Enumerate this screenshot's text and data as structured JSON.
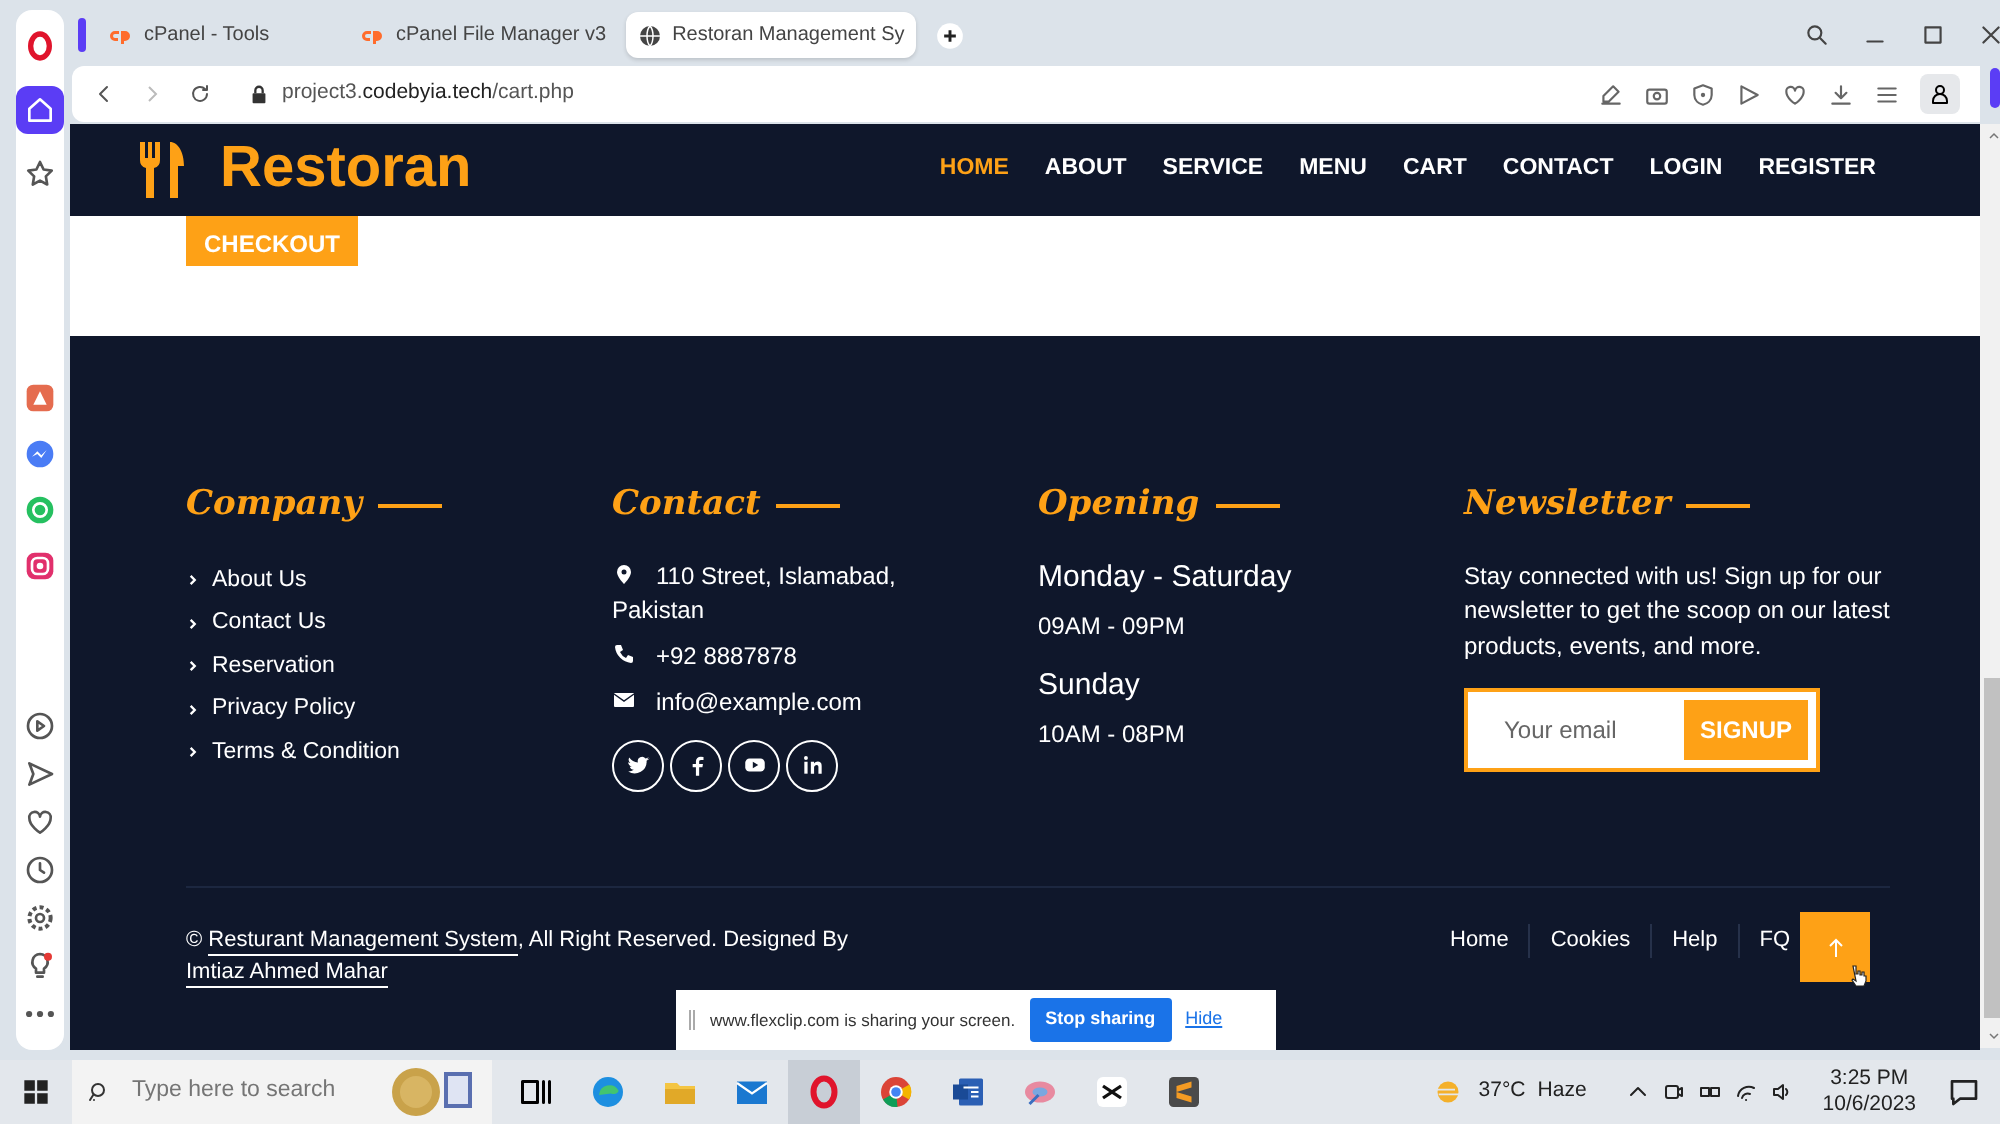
{
  "sidebar": {
    "top": [
      {
        "kind": "opera",
        "selected": false
      },
      {
        "kind": "home",
        "selected": true
      },
      {
        "kind": "star",
        "selected": false
      }
    ],
    "apps": [
      {
        "kind": "aria",
        "selected": false
      },
      {
        "kind": "messenger",
        "selected": false
      },
      {
        "kind": "whatsapp",
        "selected": false
      },
      {
        "kind": "instagram",
        "selected": false
      }
    ],
    "bottom": [
      {
        "kind": "player",
        "selected": false
      },
      {
        "kind": "send",
        "selected": false
      },
      {
        "kind": "heart",
        "selected": false
      },
      {
        "kind": "history",
        "selected": false
      },
      {
        "kind": "settings",
        "selected": false
      },
      {
        "kind": "tips",
        "selected": false
      },
      {
        "kind": "more",
        "selected": false
      }
    ]
  },
  "tabs": [
    {
      "label": "cPanel - Tools",
      "kind": "cpanel",
      "selected": false
    },
    {
      "label": "cPanel File Manager v3",
      "kind": "cpanel",
      "selected": false
    },
    {
      "label": "Restoran Management Sy",
      "kind": "globe",
      "selected": true
    }
  ],
  "address_bar": {
    "url": "project3.**codebyia.tech**/cart.php"
  },
  "site": {
    "brand": "Restoran",
    "nav": [
      {
        "label": "HOME",
        "selected": true
      },
      {
        "label": "ABOUT",
        "selected": false
      },
      {
        "label": "SERVICE",
        "selected": false
      },
      {
        "label": "MENU",
        "selected": false
      },
      {
        "label": "CART",
        "selected": false
      },
      {
        "label": "CONTACT",
        "selected": false
      },
      {
        "label": "LOGIN",
        "selected": false
      },
      {
        "label": "REGISTER",
        "selected": false
      }
    ],
    "checkout": "CHECKOUT"
  },
  "footer": {
    "columns": [
      {
        "kind": "links",
        "title": "Company",
        "items": [
          "About Us",
          "Contact Us",
          "Reservation",
          "Privacy Policy",
          "Terms & Condition"
        ]
      },
      {
        "kind": "contact",
        "title": "Contact",
        "items": [
          {
            "kind": "address",
            "text": "110 Street, Islamabad, Pakistan"
          },
          {
            "kind": "phone",
            "text": "+92 8887878"
          },
          {
            "kind": "email",
            "text": "info@example.com"
          }
        ],
        "social": [
          {
            "kind": "twitter"
          },
          {
            "kind": "facebook"
          },
          {
            "kind": "youtube"
          },
          {
            "kind": "linkedin"
          }
        ]
      },
      {
        "kind": "hours",
        "title": "Opening",
        "items": [
          {
            "day": "Monday - Saturday",
            "time": "09AM - 09PM"
          },
          {
            "day": "Sunday",
            "time": "10AM - 08PM"
          }
        ]
      },
      {
        "kind": "newsletter",
        "title": "Newsletter",
        "text": "Stay connected with us! Sign up for our newsletter to get the scoop on our latest products, events, and more.",
        "placeholder": "Your email",
        "button": "SIGNUP"
      }
    ],
    "copyright": [
      {
        "text": "© ",
        "link": false
      },
      {
        "text": "Resturant Management System",
        "link": true
      },
      {
        "text": ", All Right Reserved. Designed By ",
        "link": false
      },
      {
        "text": "Imtiaz Ahmed Mahar",
        "link": true
      }
    ],
    "links": [
      "Home",
      "Cookies",
      "Help",
      "FQ"
    ]
  },
  "share_bar": {
    "message": "www.flexclip.com is sharing your screen.",
    "stop": "Stop sharing",
    "hide": "Hide"
  },
  "taskbar": {
    "search_placeholder": "Type here to search",
    "apps": [
      {
        "kind": "taskview",
        "selected": false
      },
      {
        "kind": "edge",
        "selected": false
      },
      {
        "kind": "folder",
        "selected": false
      },
      {
        "kind": "mail",
        "selected": false
      },
      {
        "kind": "opera",
        "selected": true
      },
      {
        "kind": "chrome",
        "selected": false
      },
      {
        "kind": "word",
        "selected": false
      },
      {
        "kind": "disc",
        "selected": false
      },
      {
        "kind": "capcut",
        "selected": false
      },
      {
        "kind": "sublime",
        "selected": false
      }
    ],
    "weather": {
      "temp": "37°C",
      "condition": "Haze"
    },
    "time": "3:25 PM",
    "date": "10/6/2023"
  }
}
